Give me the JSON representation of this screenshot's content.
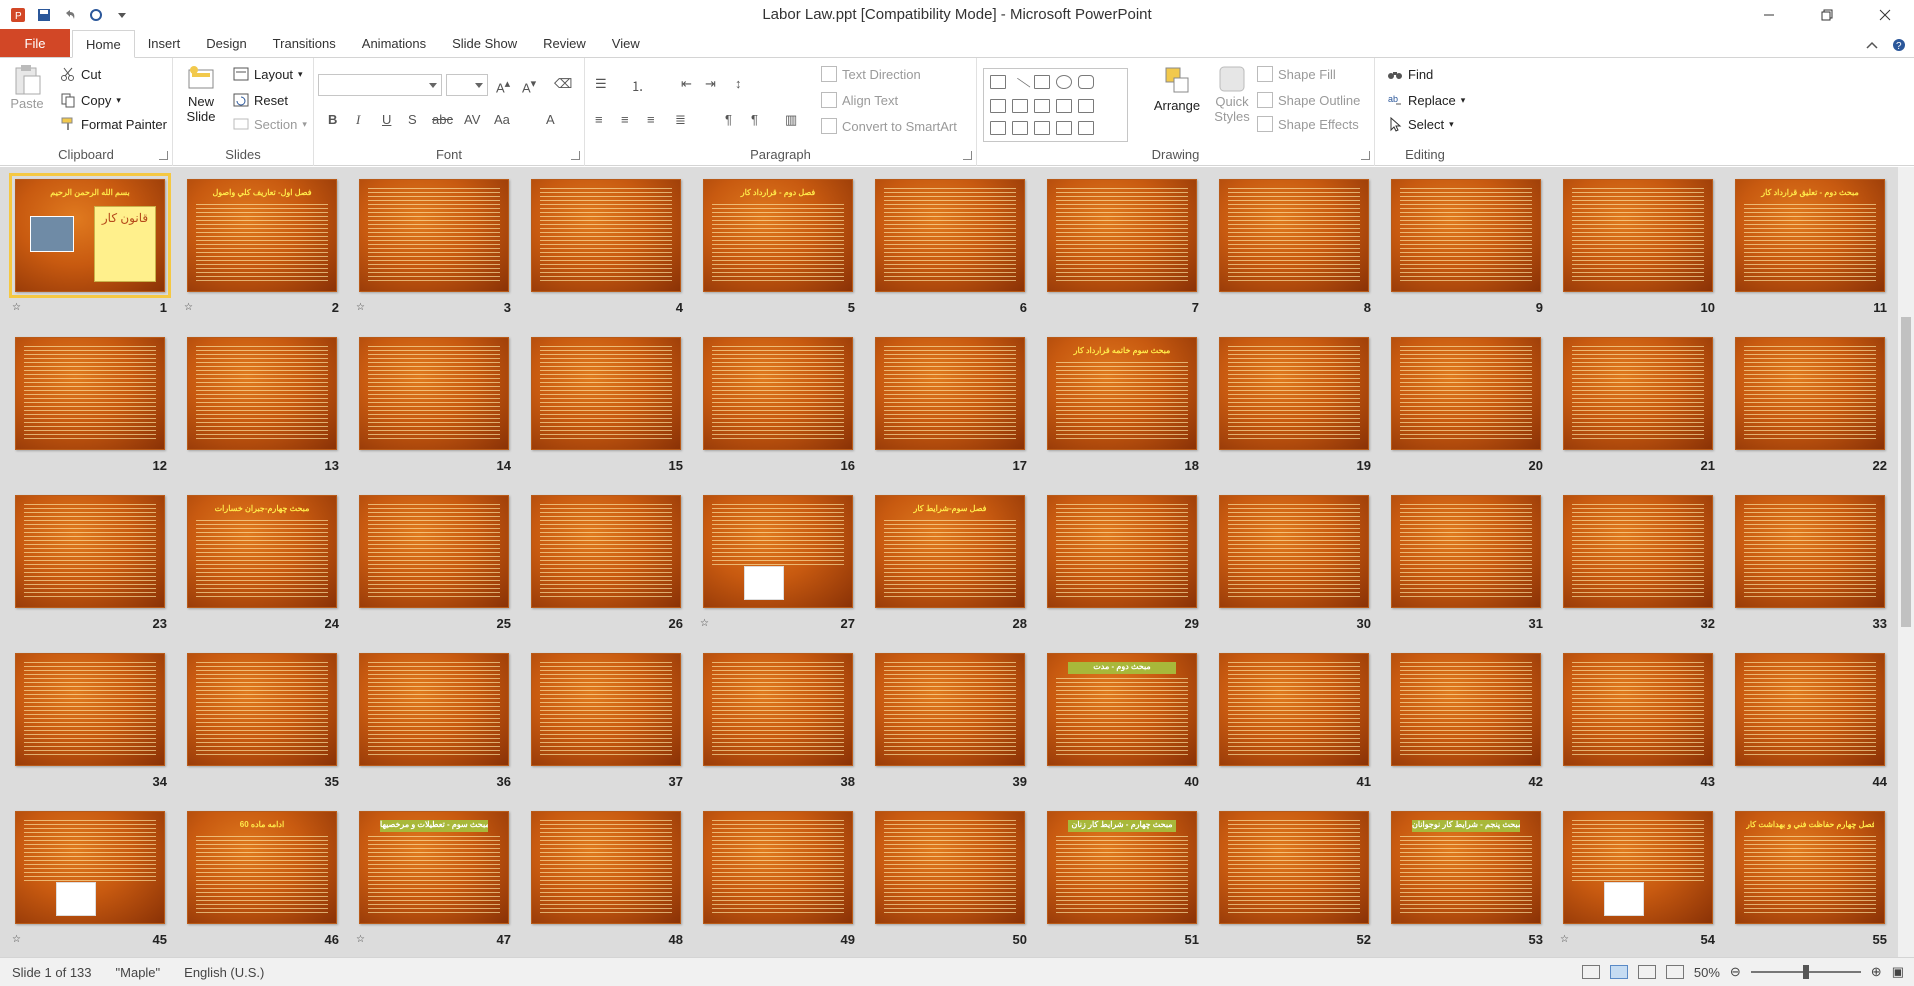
{
  "window": {
    "title": "Labor Law.ppt [Compatibility Mode]  -  Microsoft PowerPoint"
  },
  "ribbon_tabs": [
    "File",
    "Home",
    "Insert",
    "Design",
    "Transitions",
    "Animations",
    "Slide Show",
    "Review",
    "View"
  ],
  "clipboard": {
    "paste": "Paste",
    "cut": "Cut",
    "copy": "Copy",
    "format_painter": "Format Painter",
    "label": "Clipboard"
  },
  "slides_group": {
    "new_slide_line1": "New",
    "new_slide_line2": "Slide",
    "layout": "Layout",
    "reset": "Reset",
    "section": "Section",
    "label": "Slides"
  },
  "font_group": {
    "label": "Font"
  },
  "paragraph_group": {
    "text_direction": "Text Direction",
    "align_text": "Align Text",
    "convert_smartart": "Convert to SmartArt",
    "label": "Paragraph"
  },
  "drawing_group": {
    "arrange": "Arrange",
    "quick_styles_line1": "Quick",
    "quick_styles_line2": "Styles",
    "shape_fill": "Shape Fill",
    "shape_outline": "Shape Outline",
    "shape_effects": "Shape Effects",
    "label": "Drawing"
  },
  "editing_group": {
    "find": "Find",
    "replace": "Replace",
    "select": "Select",
    "label": "Editing"
  },
  "slides": [
    {
      "n": "1",
      "kind": "cover",
      "title": "بسم الله الرحمن الرحيم",
      "box": "قانون كار"
    },
    {
      "n": "2",
      "kind": "text",
      "title": "فصل اول- تعاريف كلي واصول"
    },
    {
      "n": "3",
      "kind": "text"
    },
    {
      "n": "4",
      "kind": "text"
    },
    {
      "n": "5",
      "kind": "text",
      "title": "فصل دوم - قرارداد كار"
    },
    {
      "n": "6",
      "kind": "text"
    },
    {
      "n": "7",
      "kind": "text"
    },
    {
      "n": "8",
      "kind": "text"
    },
    {
      "n": "9",
      "kind": "text"
    },
    {
      "n": "10",
      "kind": "text"
    },
    {
      "n": "11",
      "kind": "text",
      "title": "مبحث دوم - تعليق قرارداد كار"
    },
    {
      "n": "12",
      "kind": "text"
    },
    {
      "n": "13",
      "kind": "text"
    },
    {
      "n": "14",
      "kind": "text"
    },
    {
      "n": "15",
      "kind": "text"
    },
    {
      "n": "16",
      "kind": "text"
    },
    {
      "n": "17",
      "kind": "text"
    },
    {
      "n": "18",
      "kind": "text",
      "title": "مبحث سوم خاتمه قرارداد كار"
    },
    {
      "n": "19",
      "kind": "text"
    },
    {
      "n": "20",
      "kind": "text"
    },
    {
      "n": "21",
      "kind": "text"
    },
    {
      "n": "22",
      "kind": "text"
    },
    {
      "n": "23",
      "kind": "text"
    },
    {
      "n": "24",
      "kind": "text",
      "title": "مبحث چهارم-جبران خسارات"
    },
    {
      "n": "25",
      "kind": "text"
    },
    {
      "n": "26",
      "kind": "text"
    },
    {
      "n": "27",
      "kind": "figure"
    },
    {
      "n": "28",
      "kind": "text",
      "title": "فصل سوم-شرايط كار"
    },
    {
      "n": "29",
      "kind": "text"
    },
    {
      "n": "30",
      "kind": "text"
    },
    {
      "n": "31",
      "kind": "text"
    },
    {
      "n": "32",
      "kind": "text"
    },
    {
      "n": "33",
      "kind": "text"
    },
    {
      "n": "34",
      "kind": "text"
    },
    {
      "n": "35",
      "kind": "text"
    },
    {
      "n": "36",
      "kind": "text"
    },
    {
      "n": "37",
      "kind": "text"
    },
    {
      "n": "38",
      "kind": "text"
    },
    {
      "n": "39",
      "kind": "text"
    },
    {
      "n": "40",
      "kind": "boxed",
      "title": "مبحث دوم - مدت"
    },
    {
      "n": "41",
      "kind": "text"
    },
    {
      "n": "42",
      "kind": "text"
    },
    {
      "n": "43",
      "kind": "text"
    },
    {
      "n": "44",
      "kind": "text"
    },
    {
      "n": "45",
      "kind": "figure"
    },
    {
      "n": "46",
      "kind": "text",
      "title": "ادامه ماده 60"
    },
    {
      "n": "47",
      "kind": "boxed",
      "title": "مبحث سوم - تعطيلات و مرخصيها"
    },
    {
      "n": "48",
      "kind": "text"
    },
    {
      "n": "49",
      "kind": "text"
    },
    {
      "n": "50",
      "kind": "text"
    },
    {
      "n": "51",
      "kind": "boxed",
      "title": "مبحث چهارم - شرايط كار زنان"
    },
    {
      "n": "52",
      "kind": "text"
    },
    {
      "n": "53",
      "kind": "boxed",
      "title": "مبحث پنجم - شرايط كار نوجوانان"
    },
    {
      "n": "54",
      "kind": "figure"
    },
    {
      "n": "55",
      "kind": "text",
      "title": "فصل چهارم حفاظت فني و بهداشت كار"
    }
  ],
  "status": {
    "slide": "Slide 1 of 133",
    "theme": "\"Maple\"",
    "language": "English (U.S.)",
    "zoom": "50%"
  },
  "colors": {
    "file_tab": "#d24726",
    "slide_bg": "#c85a10",
    "selected": "#f5c842"
  }
}
